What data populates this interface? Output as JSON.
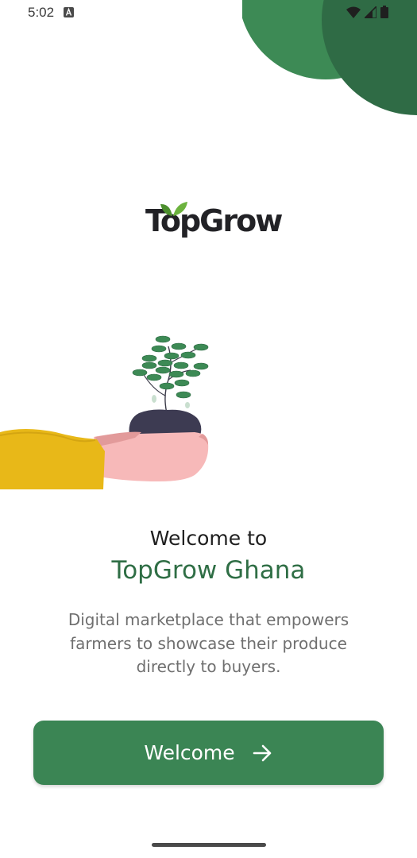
{
  "status_bar": {
    "time": "5:02",
    "notification_icon": "app-notification-icon",
    "icons": [
      "wifi-icon",
      "cellular-signal-icon",
      "battery-icon"
    ]
  },
  "logo": {
    "text": "TopGrow",
    "leaf_icon": "leaf-icon"
  },
  "hero": {
    "title_line": "Welcome to",
    "brand_line": "TopGrow Ghana",
    "description": "Digital marketplace that empowers farmers to showcase their produce directly to buyers."
  },
  "cta": {
    "label": "Welcome",
    "icon": "arrow-right-icon"
  },
  "colors": {
    "accent": "#3b8554",
    "brand_text": "#2f6e45",
    "decor_light": "#3d8a55",
    "decor_dark": "#2f6b45"
  }
}
